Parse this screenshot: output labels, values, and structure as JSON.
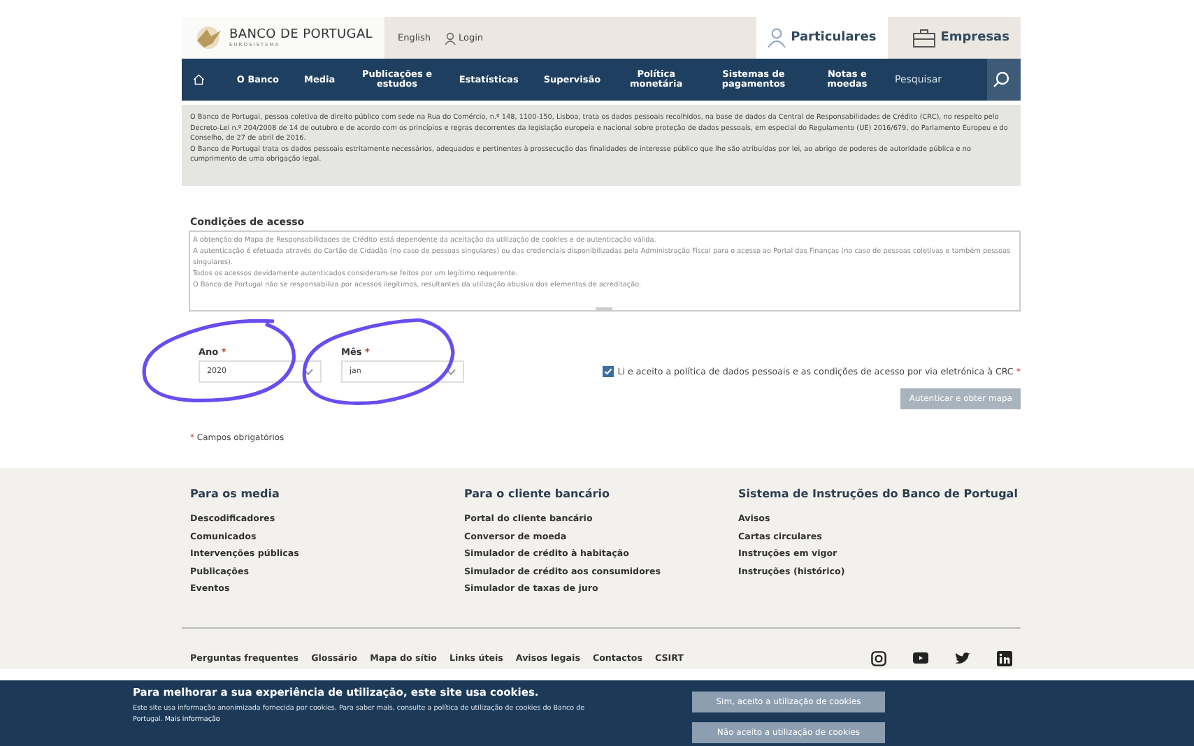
{
  "header": {
    "logo": {
      "name_1": "BANCO DE PORTUGAL",
      "name_2": "EUROSISTEMA"
    },
    "links": [
      {
        "kind": "language",
        "label": "English"
      },
      {
        "kind": "login",
        "label": "Login"
      }
    ],
    "audiences": [
      {
        "label": "Particulares",
        "selected": true,
        "kind": "person"
      },
      {
        "label": "Empresas",
        "selected": false,
        "kind": "briefcase"
      }
    ]
  },
  "nav": {
    "items": [
      "O Banco",
      "Media",
      "Publicações e estudos",
      "Estatísticas",
      "Supervisão",
      "Política monetária",
      "Sistemas de pagamentos",
      "Notas e moedas"
    ],
    "search": {
      "placeholder": "Pesquisar"
    }
  },
  "info": {
    "paragraphs": [
      "O Banco de Portugal, pessoa coletiva de direito público com sede na Rua do Comércio, n.º 148, 1100-150, Lisboa, trata os dados pessoais recolhidos, na base de dados da Central de Responsabilidades de Crédito (CRC), no respeito pelo Decreto-Lei n.º 204/2008 de 14 de outubro e de acordo com os princípios e regras decorrentes da legislação europeia e nacional sobre proteção de dados pessoais, em especial do Regulamento (UE) 2016/679, do Parlamento Europeu e do Conselho, de 27 de abril de 2016.",
      "O Banco de Portugal trata os dados pessoais estritamente necessários, adequados e pertinentes à prossecução das finalidades de interesse público que lhe são atribuídas por lei, ao abrigo de poderes de autoridade pública e no cumprimento de uma obrigação legal."
    ]
  },
  "access": {
    "heading": "Condições de acesso",
    "paragraphs": [
      "A obtenção do Mapa de Responsabilidades de Crédito está dependente da aceitação da utilização de cookies e de autenticação válida.",
      "A autenticação é efetuada através do Cartão de Cidadão (no caso de pessoas singulares) ou das credenciais disponibilizadas pela Administração Fiscal para o acesso ao Portal das Finanças (no caso de pessoas coletivas e também pessoas singulares).",
      "Todos os acessos devidamente autenticados consideram-se feitos por um legítimo requerente.",
      "O Banco de Portugal não se responsabiliza por acessos ilegítimos, resultantes da utilização abusiva dos elementos de acreditação."
    ]
  },
  "form": {
    "required_mark": "*",
    "fields": [
      {
        "label": "Ano",
        "required": true,
        "value": "2020"
      },
      {
        "label": "Mês",
        "required": true,
        "value": "jan"
      }
    ],
    "consent": {
      "text": "Li e aceito a política de dados pessoais e as condições de acesso por via eletrónica à CRC",
      "checked": true,
      "required": true
    },
    "submit": {
      "label": "Autenticar e obter mapa",
      "disabled": true
    },
    "required_note": "Campos obrigatórios"
  },
  "footer": {
    "columns": [
      {
        "heading": "Para os media",
        "links": [
          "Descodificadores",
          "Comunicados",
          "Intervenções públicas",
          "Publicações",
          "Eventos"
        ]
      },
      {
        "heading": "Para o cliente bancário",
        "links": [
          "Portal do cliente bancário",
          "Conversor de moeda",
          "Simulador de crédito à habitação",
          "Simulador de crédito aos consumidores",
          "Simulador de taxas de juro"
        ]
      },
      {
        "heading": "Sistema de Instruções do Banco de Portugal",
        "links": [
          "Avisos",
          "Cartas circulares",
          "Instruções em vigor",
          "Instruções (histórico)"
        ]
      }
    ],
    "bottom_links": [
      "Perguntas frequentes",
      "Glossário",
      "Mapa do sítio",
      "Links úteis",
      "Avisos legais",
      "Contactos",
      "CSIRT"
    ],
    "social": [
      {
        "kind": "instagram"
      },
      {
        "kind": "youtube"
      },
      {
        "kind": "twitter"
      },
      {
        "kind": "linkedin"
      }
    ]
  },
  "cookies": {
    "title": "Para melhorar a sua experiência de utilização, este site usa cookies.",
    "text": "Este site usa informação anonimizada fornecida por cookies. Para saber mais, consulte a política de utilização de cookies do Banco de Portugal.",
    "link": "Mais informação",
    "buttons": [
      "Sim, aceito a utilização de cookies",
      "Não aceito a utilização de cookies"
    ]
  }
}
